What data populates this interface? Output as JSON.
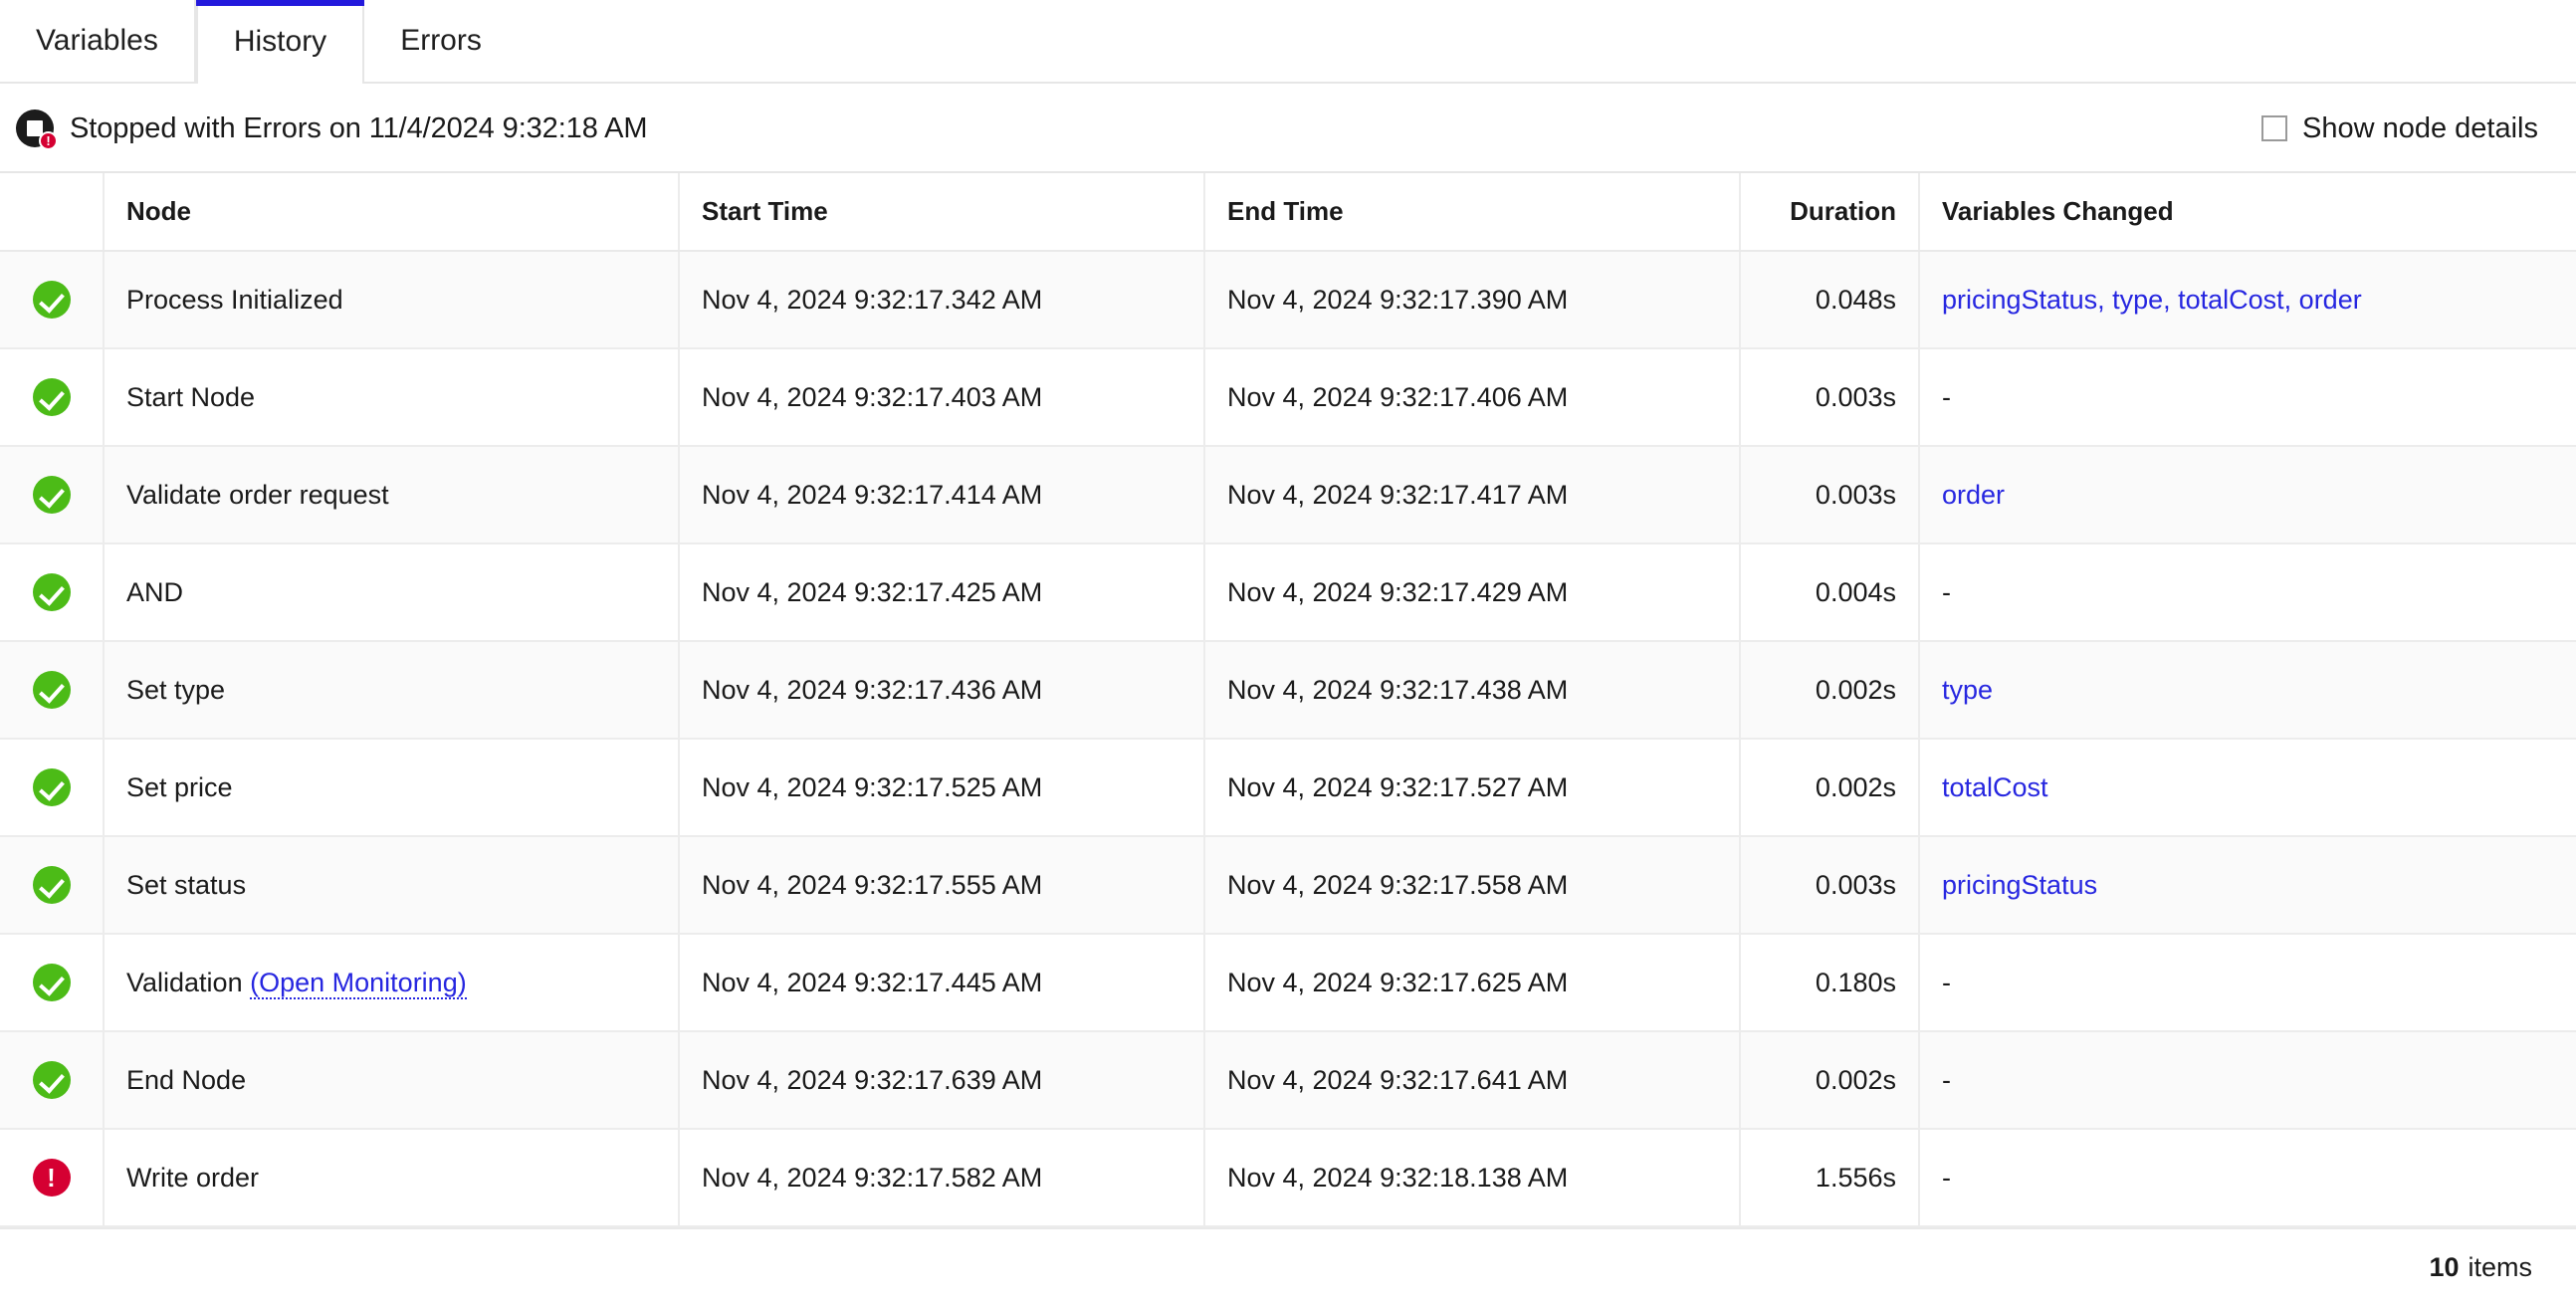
{
  "tabs": [
    {
      "label": "Variables",
      "active": false
    },
    {
      "label": "History",
      "active": true
    },
    {
      "label": "Errors",
      "active": false
    }
  ],
  "status": {
    "icon": "stop-with-error-icon",
    "badge": "!",
    "text": "Stopped with Errors on 11/4/2024 9:32:18 AM"
  },
  "show_node_details": {
    "label": "Show node details",
    "checked": false
  },
  "table": {
    "columns": [
      "",
      "Node",
      "Start Time",
      "End Time",
      "Duration",
      "Variables Changed"
    ],
    "rows": [
      {
        "status": "success",
        "node": "Process Initialized",
        "node_link": "",
        "start": "Nov 4, 2024 9:32:17.342 AM",
        "end": "Nov 4, 2024 9:32:17.390 AM",
        "duration": "0.048s",
        "variables": "pricingStatus, type, totalCost, order",
        "variables_is_link": true
      },
      {
        "status": "success",
        "node": "Start Node",
        "node_link": "",
        "start": "Nov 4, 2024 9:32:17.403 AM",
        "end": "Nov 4, 2024 9:32:17.406 AM",
        "duration": "0.003s",
        "variables": "-",
        "variables_is_link": false
      },
      {
        "status": "success",
        "node": "Validate order request",
        "node_link": "",
        "start": "Nov 4, 2024 9:32:17.414 AM",
        "end": "Nov 4, 2024 9:32:17.417 AM",
        "duration": "0.003s",
        "variables": "order",
        "variables_is_link": true
      },
      {
        "status": "success",
        "node": "AND",
        "node_link": "",
        "start": "Nov 4, 2024 9:32:17.425 AM",
        "end": "Nov 4, 2024 9:32:17.429 AM",
        "duration": "0.004s",
        "variables": "-",
        "variables_is_link": false
      },
      {
        "status": "success",
        "node": "Set type",
        "node_link": "",
        "start": "Nov 4, 2024 9:32:17.436 AM",
        "end": "Nov 4, 2024 9:32:17.438 AM",
        "duration": "0.002s",
        "variables": "type",
        "variables_is_link": true
      },
      {
        "status": "success",
        "node": "Set price",
        "node_link": "",
        "start": "Nov 4, 2024 9:32:17.525 AM",
        "end": "Nov 4, 2024 9:32:17.527 AM",
        "duration": "0.002s",
        "variables": "totalCost",
        "variables_is_link": true
      },
      {
        "status": "success",
        "node": "Set status",
        "node_link": "",
        "start": "Nov 4, 2024 9:32:17.555 AM",
        "end": "Nov 4, 2024 9:32:17.558 AM",
        "duration": "0.003s",
        "variables": "pricingStatus",
        "variables_is_link": true
      },
      {
        "status": "success",
        "node": "Validation",
        "node_link": "(Open Monitoring)",
        "start": "Nov 4, 2024 9:32:17.445 AM",
        "end": "Nov 4, 2024 9:32:17.625 AM",
        "duration": "0.180s",
        "variables": "-",
        "variables_is_link": false
      },
      {
        "status": "success",
        "node": "End Node",
        "node_link": "",
        "start": "Nov 4, 2024 9:32:17.639 AM",
        "end": "Nov 4, 2024 9:32:17.641 AM",
        "duration": "0.002s",
        "variables": "-",
        "variables_is_link": false
      },
      {
        "status": "error",
        "node": "Write order",
        "node_link": "",
        "start": "Nov 4, 2024 9:32:17.582 AM",
        "end": "Nov 4, 2024 9:32:18.138 AM",
        "duration": "1.556s",
        "variables": "-",
        "variables_is_link": false
      }
    ]
  },
  "footer": {
    "count": "10",
    "items_label": "items"
  },
  "colors": {
    "tab_active_accent": "#2319dc",
    "link": "#2626e0",
    "success": "#4cbb17",
    "error": "#d50032",
    "row_alt": "#fafafa",
    "border": "#ececec"
  }
}
